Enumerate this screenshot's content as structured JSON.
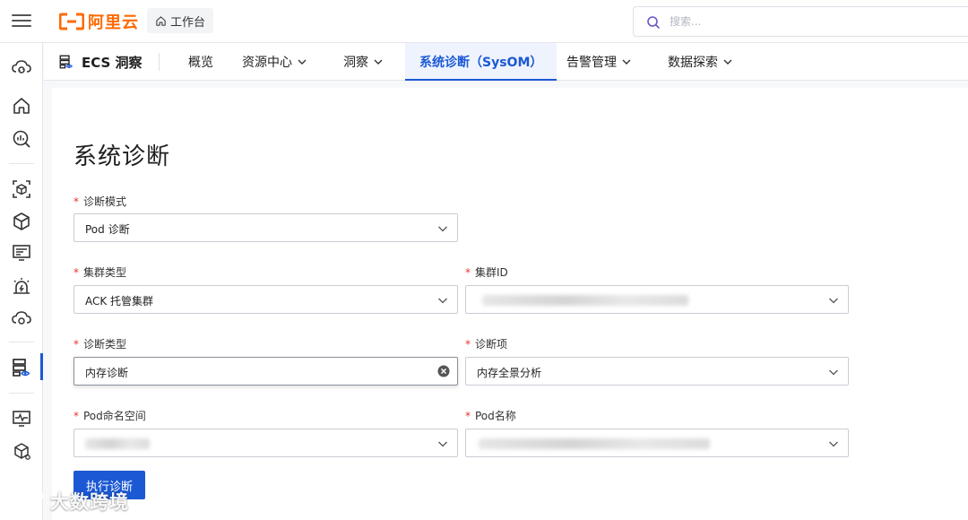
{
  "topbar": {
    "brand": "阿里云",
    "brand_color": "#ff6a00",
    "workbench_label": "工作台",
    "search_placeholder": "搜索..."
  },
  "rail": {
    "icons": [
      "cloud-sync-icon",
      "home-icon",
      "search-report-icon",
      "box-scan-icon",
      "cube-icon",
      "monitor-list-icon",
      "alarm-icon",
      "cloud-sync-icon",
      "server-eye-icon",
      "pulse-monitor-icon",
      "cube-network-icon"
    ],
    "active_icon": "server-eye-icon"
  },
  "product_nav": {
    "title": "ECS 洞察",
    "tabs": [
      {
        "label": "概览",
        "dropdown": false,
        "active": false
      },
      {
        "label": "资源中心",
        "dropdown": true,
        "active": false
      },
      {
        "label": "洞察",
        "dropdown": true,
        "active": false
      },
      {
        "label": "系统诊断（SysOM）",
        "dropdown": false,
        "active": true
      },
      {
        "label": "告警管理",
        "dropdown": true,
        "active": false
      },
      {
        "label": "数据探索",
        "dropdown": true,
        "active": false
      }
    ]
  },
  "page": {
    "title": "系统诊断"
  },
  "form": {
    "required_mark": "*",
    "diag_mode": {
      "label": "诊断模式",
      "value": "Pod 诊断"
    },
    "cluster_type": {
      "label": "集群类型",
      "value": "ACK 托管集群"
    },
    "cluster_id": {
      "label": "集群ID",
      "value": ""
    },
    "diag_type": {
      "label": "诊断类型",
      "value": "内存诊断"
    },
    "diag_item": {
      "label": "诊断项",
      "value": "内存全景分析"
    },
    "pod_namespace": {
      "label": "Pod命名空间",
      "value": ""
    },
    "pod_name": {
      "label": "Pod名称",
      "value": ""
    },
    "submit_label": "执行诊断"
  },
  "colors": {
    "accent": "#1b58d4",
    "required": "#e5372b"
  },
  "watermark": {
    "text": "大数跨境"
  }
}
